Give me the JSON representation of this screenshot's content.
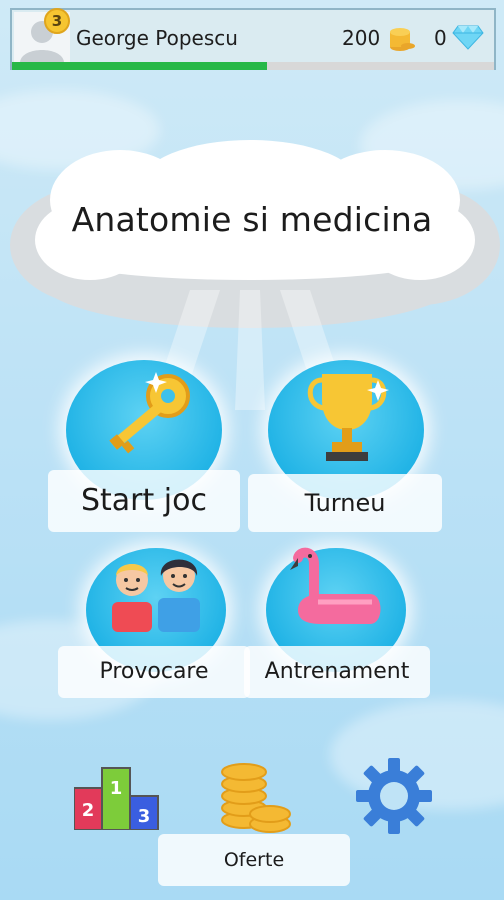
{
  "player": {
    "name": "George Popescu",
    "level": "3",
    "coins": "200",
    "gems": "0",
    "xp_progress": 0.53
  },
  "category_title": "Anatomie si medicina",
  "menu": {
    "start": "Start joc",
    "tournament": "Turneu",
    "challenge": "Provocare",
    "training": "Antrenament"
  },
  "bottom": {
    "leaderboard_icon": "podium-icon",
    "shop_label": "Oferte",
    "settings_icon": "gear-icon",
    "podium_numbers": [
      "2",
      "1",
      "3"
    ]
  },
  "colors": {
    "xp_bar": "#27b847",
    "bubble": "#22b4e6",
    "gear": "#3a7ed8"
  }
}
